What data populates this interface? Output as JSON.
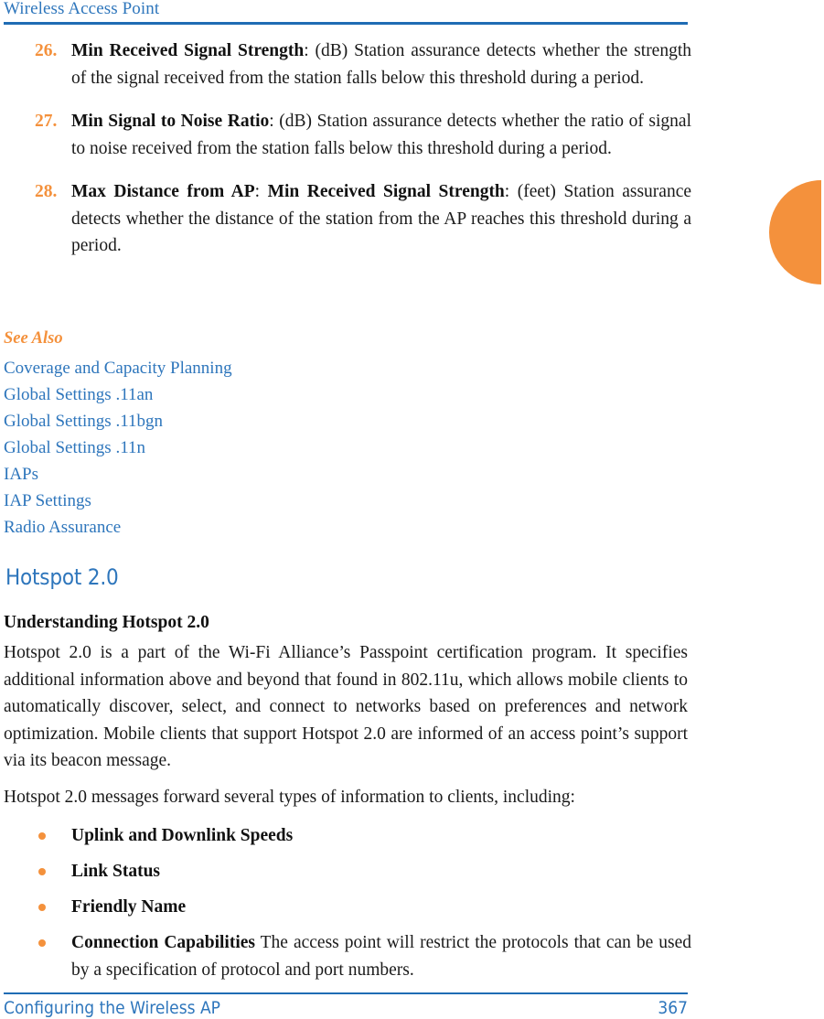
{
  "header": {
    "running_title": "Wireless Access Point"
  },
  "numbered_list": {
    "items": [
      {
        "number": "26.",
        "term": "Min Received Signal Strength",
        "body": ": (dB) Station assurance detects whether the strength of the signal received from the station falls below this threshold during a period."
      },
      {
        "number": "27.",
        "term": "Min Signal to Noise Ratio",
        "body": ": (dB) Station assurance detects whether the ratio of signal to noise received from the station falls below this threshold during a period."
      },
      {
        "number": "28.",
        "term": "Max Distance from AP",
        "separator": ": ",
        "term2": "Min Received Signal Strength",
        "body": ": (feet) Station assurance detects whether the distance of the station from the AP reaches this threshold during a period."
      }
    ]
  },
  "see_also": {
    "title": "See Also",
    "links": [
      "Coverage and Capacity Planning",
      "Global Settings .11an",
      "Global Settings .11bgn",
      "Global Settings .11n",
      "IAPs",
      "IAP Settings",
      "Radio Assurance"
    ]
  },
  "section": {
    "heading": "Hotspot 2.0",
    "subheading": "Understanding Hotspot 2.0",
    "paragraph_1": "Hotspot 2.0 is a part of the Wi-Fi Alliance’s Passpoint certification program. It specifies additional information above and beyond that found in 802.11u, which allows mobile clients to automatically discover, select, and connect to networks based on preferences and network optimization. Mobile clients that support Hotspot 2.0 are informed of an access point’s support via its beacon message.",
    "paragraph_2": "Hotspot 2.0 messages forward several types of information to clients, including:"
  },
  "bullet_list": {
    "items": [
      {
        "term": "Uplink and Downlink Speeds",
        "body": ""
      },
      {
        "term": "Link Status",
        "body": ""
      },
      {
        "term": "Friendly Name",
        "body": ""
      },
      {
        "term": "Connection Capabilities",
        "body": " The access point will restrict the protocols that can be used by a specification of protocol and port numbers."
      }
    ]
  },
  "footer": {
    "chapter": "Configuring the Wireless AP",
    "page_number": "367"
  },
  "colors": {
    "link_blue": "#2E76BC",
    "rule_blue": "#1F6CB4",
    "accent_orange": "#F4913C",
    "body_text": "#1a1a1a"
  }
}
